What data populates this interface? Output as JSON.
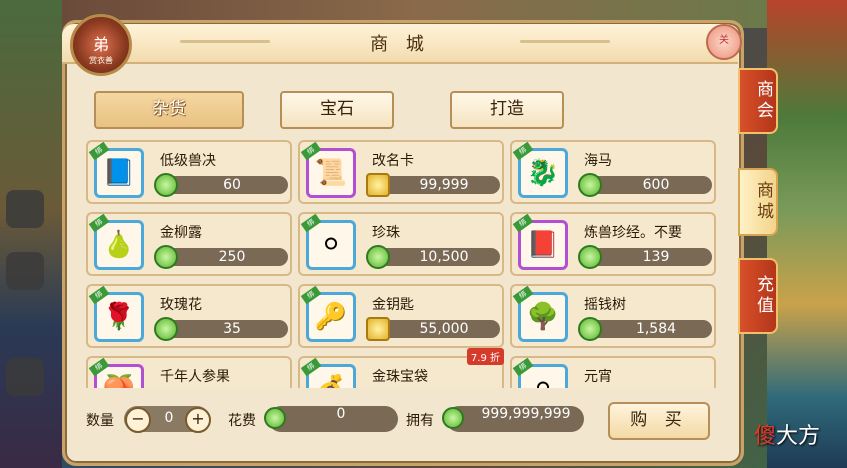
{
  "window": {
    "title": "商 城",
    "close_label": "关"
  },
  "avatar": {
    "glyph": "弟",
    "level": "赏衣善"
  },
  "tabs": [
    {
      "label": "杂货",
      "active": true
    },
    {
      "label": "宝石",
      "active": false
    },
    {
      "label": "打造",
      "active": false
    }
  ],
  "side_tabs": [
    {
      "label": "商会",
      "style": "red"
    },
    {
      "label": "商城",
      "style": "gold"
    },
    {
      "label": "充值",
      "style": "red"
    }
  ],
  "items": [
    {
      "name": "低级兽决",
      "price": "60",
      "currency": "silver",
      "frame": "blue",
      "icon": "book-icon",
      "glyph": "📘"
    },
    {
      "name": "改名卡",
      "price": "99,999",
      "currency": "gold",
      "frame": "purple",
      "icon": "scroll-icon",
      "glyph": "📜"
    },
    {
      "name": "海马",
      "price": "600",
      "currency": "silver",
      "frame": "blue",
      "icon": "seahorse-icon",
      "glyph": "🐉"
    },
    {
      "name": "金柳露",
      "price": "250",
      "currency": "silver",
      "frame": "blue",
      "icon": "bottle-icon",
      "glyph": "🍐"
    },
    {
      "name": "珍珠",
      "price": "10,500",
      "currency": "silver",
      "frame": "blue",
      "icon": "pearl-icon",
      "glyph": "⚪"
    },
    {
      "name": "炼兽珍经。不要",
      "price": "139",
      "currency": "silver",
      "frame": "purple",
      "icon": "tome-icon",
      "glyph": "📕"
    },
    {
      "name": "玫瑰花",
      "price": "35",
      "currency": "silver",
      "frame": "blue",
      "icon": "rose-icon",
      "glyph": "🌹"
    },
    {
      "name": "金钥匙",
      "price": "55,000",
      "currency": "gold",
      "frame": "blue",
      "icon": "key-icon",
      "glyph": "🔑"
    },
    {
      "name": "摇钱树",
      "price": "1,584",
      "currency": "silver",
      "frame": "blue",
      "icon": "money-tree-icon",
      "glyph": "🌳"
    },
    {
      "name": "千年人参果",
      "price": "",
      "currency": "silver",
      "frame": "purple",
      "icon": "ginseng-icon",
      "glyph": "🍑"
    },
    {
      "name": "金珠宝袋",
      "price": "",
      "currency": "silver",
      "frame": "blue",
      "icon": "bag-icon",
      "glyph": "💰",
      "discount": "7.9 折"
    },
    {
      "name": "元宵",
      "price": "",
      "currency": "silver",
      "frame": "blue",
      "icon": "dumpling-icon",
      "glyph": "⚪"
    }
  ],
  "ribbon_label": "绑",
  "bottom": {
    "qty_label": "数量",
    "qty_value": "0",
    "cost_label": "花费",
    "cost_value": "0",
    "own_label": "拥有",
    "own_value": "999,999,999",
    "buy_label": "购 买"
  },
  "watermark": {
    "red": "傻",
    "white": "大方"
  },
  "colors": {
    "panel_bg": "#f3e6cf",
    "accent_red": "#d9502a",
    "price_bar": "#7a6a55",
    "frame_blue": "#4aa9d8",
    "frame_purple": "#b24fd2"
  }
}
